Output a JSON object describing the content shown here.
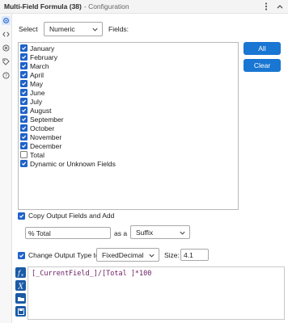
{
  "window": {
    "title": "Multi-Field Formula (38)",
    "subtitle": "- Configuration"
  },
  "select": {
    "label": "Select",
    "value": "Numeric",
    "fields_label": "Fields:"
  },
  "fields": [
    {
      "label": "January",
      "checked": true
    },
    {
      "label": "February",
      "checked": true
    },
    {
      "label": "March",
      "checked": true
    },
    {
      "label": "April",
      "checked": true
    },
    {
      "label": "May",
      "checked": true
    },
    {
      "label": "June",
      "checked": true
    },
    {
      "label": "July",
      "checked": true
    },
    {
      "label": "August",
      "checked": true
    },
    {
      "label": "September",
      "checked": true
    },
    {
      "label": "October",
      "checked": true
    },
    {
      "label": "November",
      "checked": true
    },
    {
      "label": "December",
      "checked": true
    },
    {
      "label": "Total",
      "checked": false
    },
    {
      "label": "Dynamic or Unknown Fields",
      "checked": true
    }
  ],
  "buttons": {
    "all": "All",
    "clear": "Clear"
  },
  "copy_output": {
    "label": "Copy Output Fields and Add",
    "checked": true,
    "name_value": "% Total",
    "as_a": "as a",
    "position": "Suffix"
  },
  "change_type": {
    "label": "Change Output Type to",
    "checked": true,
    "type": "FixedDecimal",
    "size_label": "Size:",
    "size": "4.1"
  },
  "expression": {
    "text": "[_CurrentField_]/[Total ]*100"
  },
  "colors": {
    "accent": "#1976d2",
    "checkbox": "#1f62c9",
    "editor_icons": "#1a5aa6"
  }
}
